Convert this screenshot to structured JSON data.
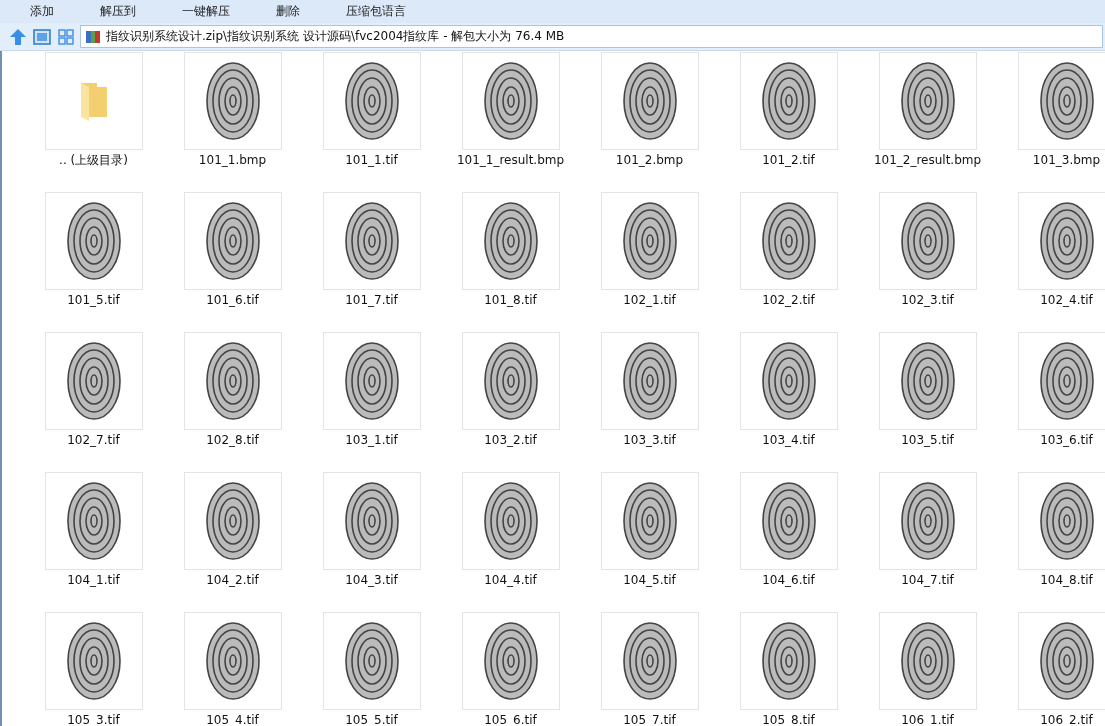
{
  "toolbar": [
    "添加",
    "解压到",
    "一键解压",
    "删除",
    "压缩包语言"
  ],
  "address": {
    "path": "指纹识别系统设计.zip\\指纹识别系统 设计源码\\fvc2004指纹库 - 解包大小为 76.4 MB"
  },
  "files": [
    {
      "kind": "folder",
      "name": ".. (上级目录)"
    },
    {
      "kind": "image",
      "name": "101_1.bmp"
    },
    {
      "kind": "image",
      "name": "101_1.tif"
    },
    {
      "kind": "image",
      "name": "101_1_result.bmp"
    },
    {
      "kind": "image",
      "name": "101_2.bmp"
    },
    {
      "kind": "image",
      "name": "101_2.tif"
    },
    {
      "kind": "image",
      "name": "101_2_result.bmp"
    },
    {
      "kind": "image",
      "name": "101_3.bmp"
    },
    {
      "kind": "image",
      "name": "101_5.tif"
    },
    {
      "kind": "image",
      "name": "101_6.tif"
    },
    {
      "kind": "image",
      "name": "101_7.tif"
    },
    {
      "kind": "image",
      "name": "101_8.tif"
    },
    {
      "kind": "image",
      "name": "102_1.tif"
    },
    {
      "kind": "image",
      "name": "102_2.tif"
    },
    {
      "kind": "image",
      "name": "102_3.tif"
    },
    {
      "kind": "image",
      "name": "102_4.tif"
    },
    {
      "kind": "image",
      "name": "102_7.tif"
    },
    {
      "kind": "image",
      "name": "102_8.tif"
    },
    {
      "kind": "image",
      "name": "103_1.tif"
    },
    {
      "kind": "image",
      "name": "103_2.tif"
    },
    {
      "kind": "image",
      "name": "103_3.tif"
    },
    {
      "kind": "image",
      "name": "103_4.tif"
    },
    {
      "kind": "image",
      "name": "103_5.tif"
    },
    {
      "kind": "image",
      "name": "103_6.tif"
    },
    {
      "kind": "image",
      "name": "104_1.tif"
    },
    {
      "kind": "image",
      "name": "104_2.tif"
    },
    {
      "kind": "image",
      "name": "104_3.tif"
    },
    {
      "kind": "image",
      "name": "104_4.tif"
    },
    {
      "kind": "image",
      "name": "104_5.tif"
    },
    {
      "kind": "image",
      "name": "104_6.tif"
    },
    {
      "kind": "image",
      "name": "104_7.tif"
    },
    {
      "kind": "image",
      "name": "104_8.tif"
    },
    {
      "kind": "image",
      "name": "105_3.tif"
    },
    {
      "kind": "image",
      "name": "105_4.tif"
    },
    {
      "kind": "image",
      "name": "105_5.tif"
    },
    {
      "kind": "image",
      "name": "105_6.tif"
    },
    {
      "kind": "image",
      "name": "105_7.tif"
    },
    {
      "kind": "image",
      "name": "105_8.tif"
    },
    {
      "kind": "image",
      "name": "106_1.tif"
    },
    {
      "kind": "image",
      "name": "106_2.tif"
    }
  ]
}
